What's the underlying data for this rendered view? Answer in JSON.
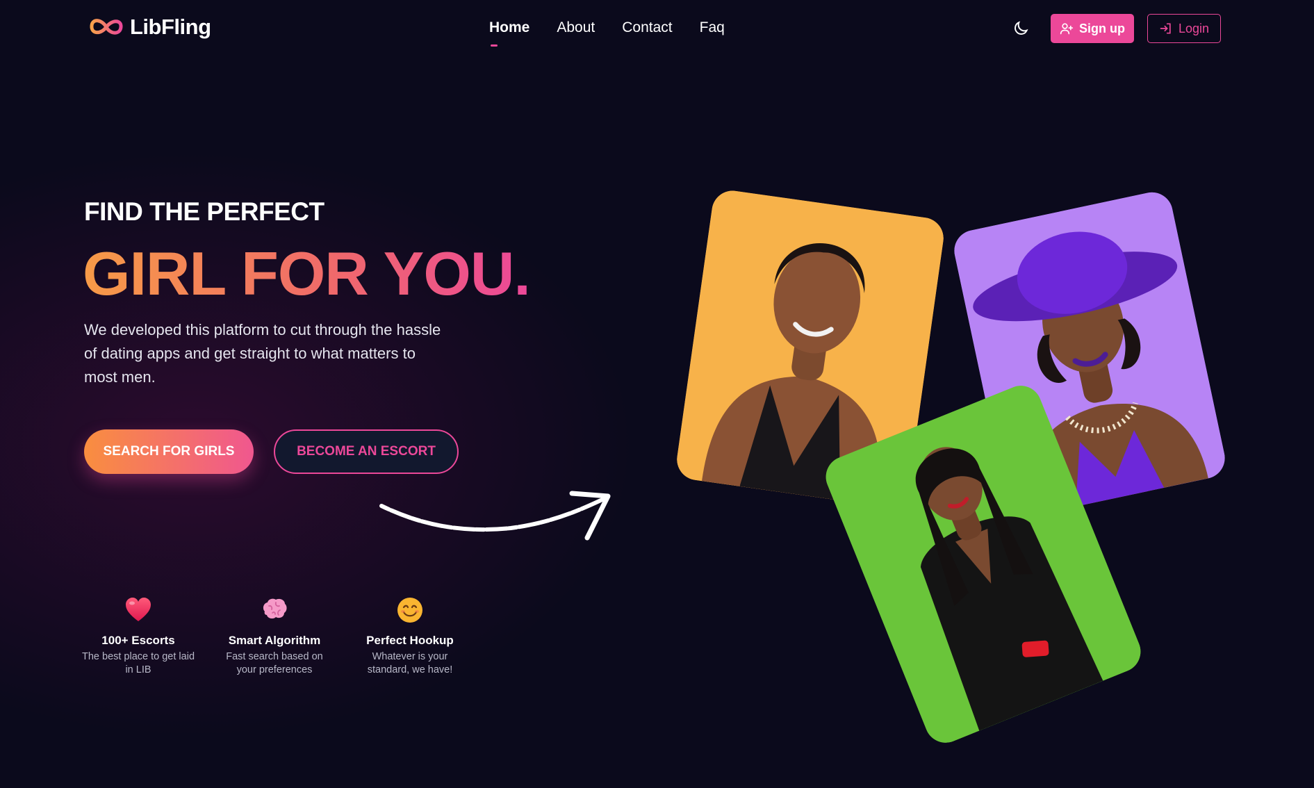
{
  "brand": {
    "name": "LibFling",
    "accent": "#ec4899",
    "orange": "#f79b47"
  },
  "nav": {
    "items": [
      {
        "label": "Home",
        "active": true
      },
      {
        "label": "About",
        "active": false
      },
      {
        "label": "Contact",
        "active": false
      },
      {
        "label": "Faq",
        "active": false
      }
    ]
  },
  "header": {
    "theme_icon": "moon-icon",
    "signup_label": "Sign up",
    "login_label": "Login"
  },
  "hero": {
    "kicker": "FIND THE PERFECT",
    "title": "GIRL FOR YOU.",
    "description": "We developed this platform to cut through the hassle of dating apps and get straight to what matters to most men.",
    "search_button": "SEARCH FOR GIRLS",
    "escort_button": "BECOME AN ESCORT"
  },
  "features": [
    {
      "icon": "heart-icon",
      "title": "100+ Escorts",
      "desc": "The best place to get laid in LIB"
    },
    {
      "icon": "brain-icon",
      "title": "Smart Algorithm",
      "desc": "Fast search based on your preferences"
    },
    {
      "icon": "smile-icon",
      "title": "Perfect Hookup",
      "desc": "Whatever is your standard, we have!"
    }
  ],
  "photo_cards": [
    {
      "name": "woman-black-dress",
      "background": "#f7b24a"
    },
    {
      "name": "woman-purple-hat",
      "background": "#b784f5"
    },
    {
      "name": "woman-black-suit",
      "background": "#6ac53a"
    }
  ]
}
